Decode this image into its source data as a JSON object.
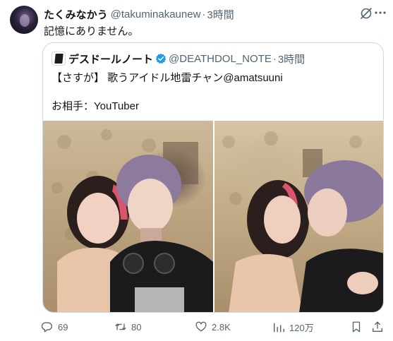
{
  "tweet": {
    "display_name": "たくみなかう",
    "handle": "@takuminakaunew",
    "separator": "·",
    "time": "3時間",
    "text": "記憶にありません。"
  },
  "quote": {
    "display_name": "デスドールノート",
    "handle": "@DEATHDOL_NOTE",
    "separator": "·",
    "time": "3時間",
    "body": "【さすが】 歌うアイドル地雷チャン@amatsuuni\n\nお相手：YouTuber",
    "verified_color": "#1d9bf0"
  },
  "actions": {
    "reply_count": "69",
    "retweet_count": "80",
    "like_count": "2.8K",
    "view_count": "120万"
  },
  "icons": {
    "grok": "grok-icon",
    "more": "more-icon",
    "reply": "reply-icon",
    "retweet": "retweet-icon",
    "like": "heart-icon",
    "views": "views-icon",
    "bookmark": "bookmark-icon",
    "share": "share-icon"
  },
  "colors": {
    "text": "#0f1419",
    "muted": "#536471",
    "border": "#cfd9de",
    "verified": "#1d9bf0"
  }
}
